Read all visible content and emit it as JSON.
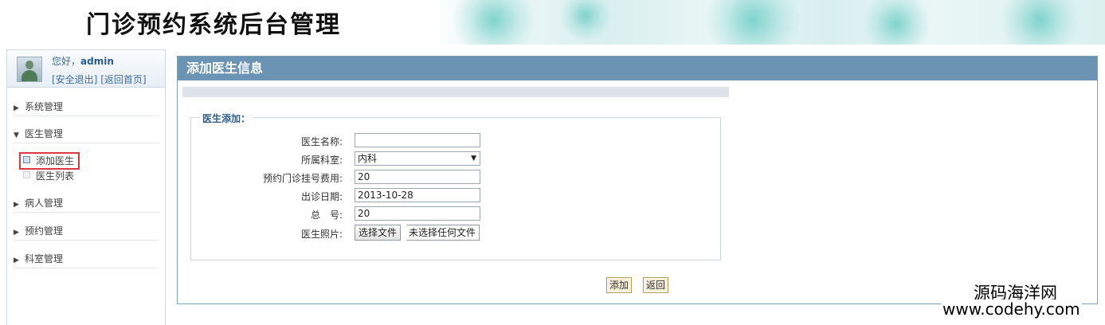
{
  "header": {
    "app_title": "门诊预约系统后台管理"
  },
  "user": {
    "greeting_prefix": "您好，",
    "username": "admin",
    "logout_link": "[安全退出]",
    "home_link": "[返回首页]"
  },
  "sidebar": {
    "groups": [
      {
        "label": "系统管理"
      },
      {
        "label": "医生管理",
        "items": [
          {
            "label": "添加医生"
          },
          {
            "label": "医生列表"
          }
        ]
      },
      {
        "label": "病人管理"
      },
      {
        "label": "预约管理"
      },
      {
        "label": "科室管理"
      }
    ]
  },
  "panel": {
    "title": "添加医生信息",
    "fieldset_legend": "医生添加：",
    "fields": {
      "name_label": "医生名称:",
      "name_value": "",
      "department_label": "所属科室:",
      "department_value": "内科",
      "fee_label": "预约门诊挂号费用:",
      "fee_value": "20",
      "date_label": "出诊日期:",
      "date_value": "2013-10-28",
      "total_label": "总　号:",
      "total_value": "20",
      "photo_label": "医生照片:",
      "photo_button": "选择文件",
      "photo_status": "未选择任何文件"
    },
    "add_button": "添加",
    "back_button": "返回"
  },
  "watermark": {
    "line1": "源码海洋网",
    "line2": "www.codehy.com"
  },
  "colors": {
    "panel_header": "#6b93b4",
    "active_outline": "#d9393f",
    "link": "#3e6ea0"
  }
}
